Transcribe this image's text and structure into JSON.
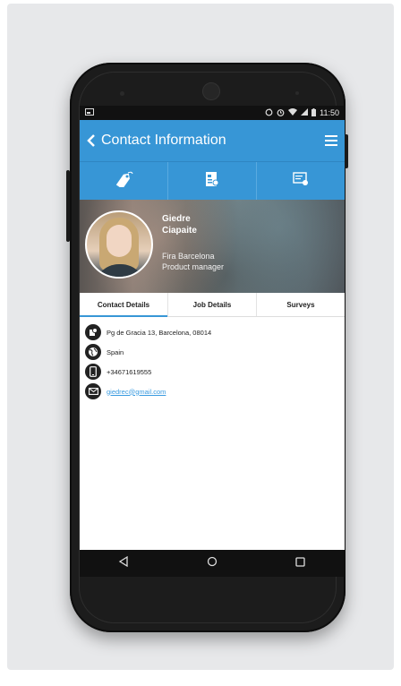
{
  "status_bar": {
    "time": "11:50",
    "icons": [
      "notification-icon",
      "sync-icon",
      "alarm-icon",
      "wifi-icon",
      "signal-icon",
      "battery-icon"
    ]
  },
  "app_bar": {
    "back_glyph": "<",
    "title": "Contact Information",
    "menu_icon": "hamburger-menu-icon"
  },
  "icon_tabs": [
    {
      "name": "tag-icon"
    },
    {
      "name": "badge-icon"
    },
    {
      "name": "survey-icon"
    }
  ],
  "profile": {
    "first_name": "Giedre",
    "last_name": "Ciapaite",
    "company": "Fira Barcelona",
    "job_title": "Product manager"
  },
  "tabs": [
    {
      "label": "Contact Details",
      "active": true
    },
    {
      "label": "Job Details",
      "active": false
    },
    {
      "label": "Surveys",
      "active": false
    }
  ],
  "contact_details": [
    {
      "icon": "address-icon",
      "text": "Pg de Gracia 13, Barcelona, 08014"
    },
    {
      "icon": "globe-icon",
      "text": "Spain"
    },
    {
      "icon": "phone-icon",
      "text": "+34671619555"
    },
    {
      "icon": "email-icon",
      "text": "giedrec@gmail.com"
    }
  ],
  "nav_bar": {
    "icons": [
      "back-nav-icon",
      "home-nav-icon",
      "recents-nav-icon"
    ]
  },
  "colors": {
    "accent": "#3796d6",
    "link": "#3a9be0",
    "phone_body": "#1c1c1c",
    "background": "#e7e8ea"
  }
}
